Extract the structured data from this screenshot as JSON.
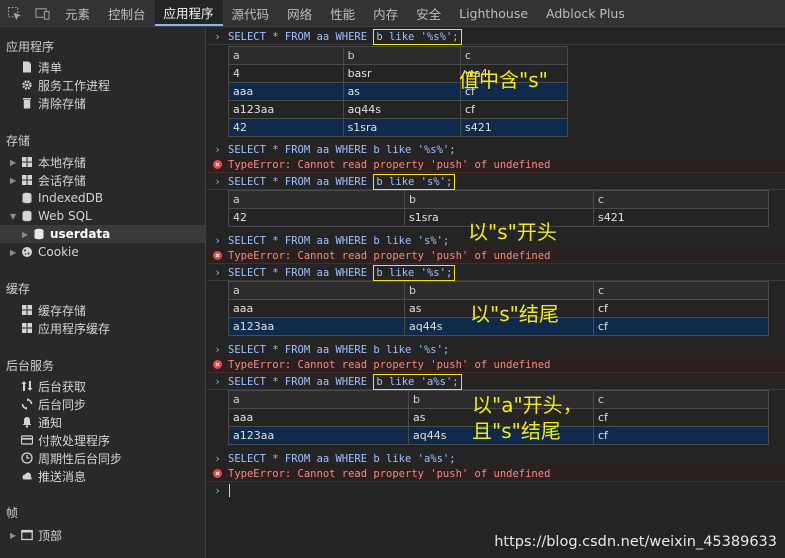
{
  "toolbar": {
    "inspect_icon": "inspect-element-icon",
    "device_icon": "device-toolbar-icon",
    "tabs": [
      "元素",
      "控制台",
      "应用程序",
      "源代码",
      "网络",
      "性能",
      "内存",
      "安全",
      "Lighthouse",
      "Adblock Plus"
    ],
    "active_tab": "应用程序"
  },
  "sidebar": {
    "app_title": "应用程序",
    "app_items": [
      "清单",
      "服务工作进程",
      "清除存储"
    ],
    "storage_title": "存储",
    "storage_items": [
      "本地存储",
      "会话存储",
      "IndexedDB",
      "Web SQL",
      "userdata",
      "Cookie"
    ],
    "cache_title": "缓存",
    "cache_items": [
      "缓存存储",
      "应用程序缓存"
    ],
    "bg_title": "后台服务",
    "bg_items": [
      "后台获取",
      "后台同步",
      "通知",
      "付款处理程序",
      "周期性后台同步",
      "推送消息"
    ],
    "frames_title": "帧",
    "frames_items": [
      "顶部"
    ]
  },
  "console": {
    "cmd_prefix": "SELECT * FROM aa WHERE ",
    "q1_hl": "b like '%s%';",
    "q1b": "SELECT * FROM aa WHERE b like '%s%';",
    "err": "TypeError: Cannot read property 'push' of undefined",
    "q2_hl": "b like 's%';",
    "q2b": "SELECT * FROM aa WHERE b like 's%';",
    "q3_hl": "b like '%s';",
    "q3b": "SELECT * FROM aa WHERE b like '%s';",
    "q4_hl": "b like 'a%s';",
    "q4b": "SELECT * FROM aa WHERE b like 'a%s';",
    "headers": [
      "a",
      "b",
      "c"
    ],
    "t1": [
      [
        "4",
        "basr",
        "wa4"
      ],
      [
        "aaa",
        "as",
        "cf"
      ],
      [
        "a123aa",
        "aq44s",
        "cf"
      ],
      [
        "42",
        "s1sra",
        "s421"
      ]
    ],
    "t2": [
      [
        "42",
        "s1sra",
        "s421"
      ]
    ],
    "t3": [
      [
        "aaa",
        "as",
        "cf"
      ],
      [
        "a123aa",
        "aq44s",
        "cf"
      ]
    ],
    "t4": [
      [
        "aaa",
        "as",
        "cf"
      ],
      [
        "a123aa",
        "aq44s",
        "cf"
      ]
    ]
  },
  "annotations": {
    "n1": "值中含\"s\"",
    "n2": "以\"s\"开头",
    "n3": "以\"s\"结尾",
    "n4": "以\"a\"开头，\n且\"s\"结尾"
  },
  "watermark": "https://blog.csdn.net/weixin_45389633",
  "colors": {
    "highlight_box": "#f2e31a",
    "annotation": "#f5ea1c",
    "error": "#f28b82",
    "selected_row": "#0f2a4a"
  }
}
